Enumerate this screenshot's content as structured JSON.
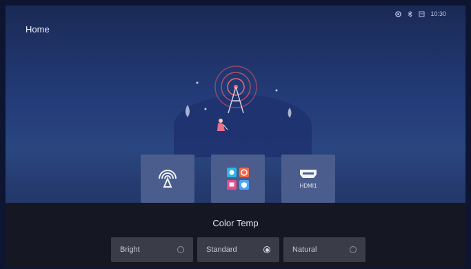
{
  "header": {
    "title": "Home"
  },
  "status": {
    "icons": [
      "network-icon",
      "bluetooth-icon",
      "input-source-icon"
    ],
    "time": "10:30"
  },
  "tiles": [
    {
      "icon": "antenna-icon",
      "label": ""
    },
    {
      "icon": "apps-grid-icon",
      "label": ""
    },
    {
      "icon": "hdmi-icon",
      "label": "HDMI1"
    }
  ],
  "color_temp_panel": {
    "title": "Color Temp",
    "options": [
      {
        "label": "Bright",
        "selected": false
      },
      {
        "label": "Standard",
        "selected": true
      },
      {
        "label": "Natural",
        "selected": false
      }
    ]
  }
}
